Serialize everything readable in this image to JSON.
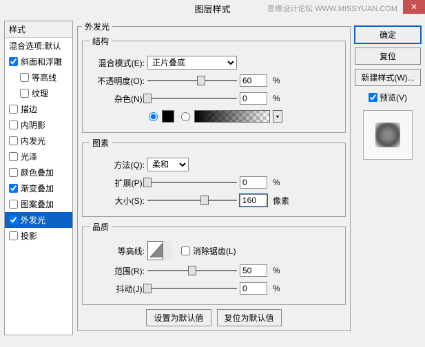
{
  "window": {
    "title": "图层样式",
    "watermark": "思缘设计论坛 WWW.MISSYUAN.COM"
  },
  "left": {
    "header": "样式",
    "blendDefault": "混合选项:默认",
    "items": [
      {
        "label": "斜面和浮雕",
        "checked": true
      },
      {
        "label": "等高线",
        "checked": false,
        "indent": true
      },
      {
        "label": "纹理",
        "checked": false,
        "indent": true
      },
      {
        "label": "描边",
        "checked": false
      },
      {
        "label": "内阴影",
        "checked": false
      },
      {
        "label": "内发光",
        "checked": false
      },
      {
        "label": "光泽",
        "checked": false
      },
      {
        "label": "颜色叠加",
        "checked": false
      },
      {
        "label": "渐变叠加",
        "checked": true
      },
      {
        "label": "图案叠加",
        "checked": false
      },
      {
        "label": "外发光",
        "checked": true,
        "selected": true
      },
      {
        "label": "投影",
        "checked": false
      }
    ]
  },
  "outer": {
    "main_legend": "外发光",
    "struct_legend": "结构",
    "blendMode_label": "混合模式(E):",
    "blendMode_value": "正片叠底",
    "opacity_label": "不透明度(O):",
    "opacity_value": "60",
    "opacity_unit": "%",
    "noise_label": "杂色(N):",
    "noise_value": "0",
    "noise_unit": "%",
    "elem_legend": "图素",
    "method_label": "方法(Q):",
    "method_value": "柔和",
    "spread_label": "扩展(P):",
    "spread_value": "0",
    "spread_unit": "%",
    "size_label": "大小(S):",
    "size_value": "160",
    "size_unit": "像素",
    "quality_legend": "品质",
    "contour_label": "等高线:",
    "antialias_label": "消除锯齿(L)",
    "range_label": "范围(R):",
    "range_value": "50",
    "range_unit": "%",
    "jitter_label": "抖动(J):",
    "jitter_value": "0",
    "jitter_unit": "%",
    "default_btn": "设置为默认值",
    "reset_btn": "复位为默认值"
  },
  "right": {
    "ok": "确定",
    "cancel": "复位",
    "newStyle": "新建样式(W)...",
    "preview": "预览(V)"
  }
}
